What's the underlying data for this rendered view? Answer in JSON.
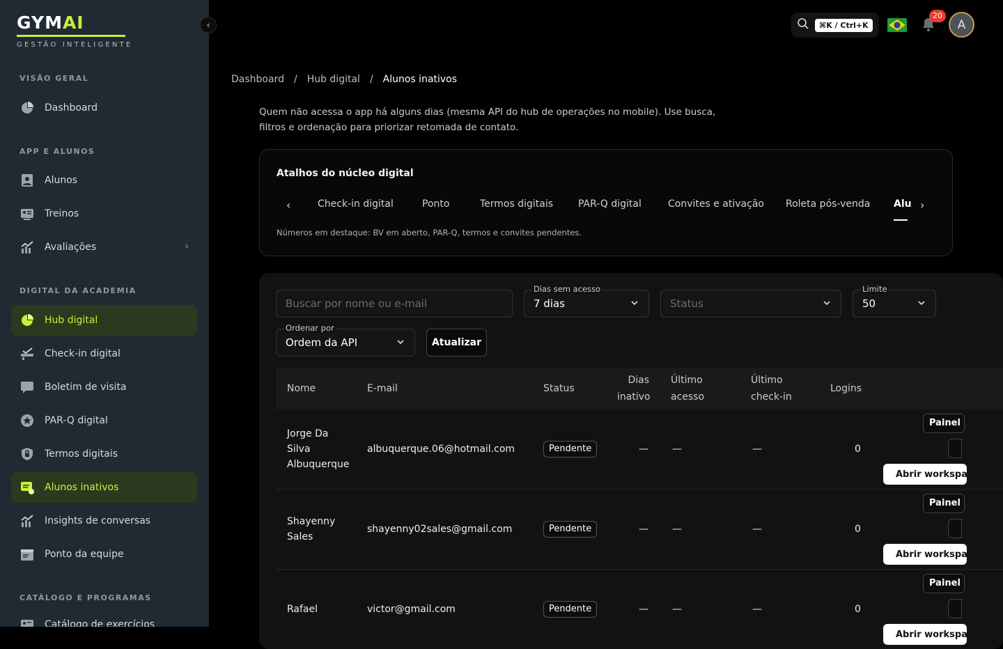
{
  "brand": {
    "logo_main": "GYM",
    "logo_accent": "AI",
    "tagline": "GESTÃO INTELIGENTE",
    "accent_color": "#c7ef3b"
  },
  "sidebar": {
    "sections": [
      {
        "label": "VISÃO GERAL"
      },
      {
        "label": "APP E ALUNOS"
      },
      {
        "label": "DIGITAL DA ACADEMIA"
      },
      {
        "label": "CATÁLOGO E PROGRAMAS"
      }
    ],
    "items": [
      {
        "label": "Dashboard",
        "icon": "pie-chart-icon"
      },
      {
        "label": "Alunos",
        "icon": "user-icon"
      },
      {
        "label": "Treinos",
        "icon": "id-card-icon"
      },
      {
        "label": "Avaliações",
        "icon": "chart-up-icon"
      },
      {
        "label": "Hub digital",
        "icon": "pie-chart-icon",
        "active": true
      },
      {
        "label": "Check-in digital",
        "icon": "checkin-icon"
      },
      {
        "label": "Boletim de visita",
        "icon": "chat-icon"
      },
      {
        "label": "PAR-Q digital",
        "icon": "star-badge-icon"
      },
      {
        "label": "Termos digitais",
        "icon": "lock-shield-icon"
      },
      {
        "label": "Alunos inativos",
        "icon": "message-alert-icon",
        "active": true
      },
      {
        "label": "Insights de conversas",
        "icon": "chart-up-icon"
      },
      {
        "label": "Ponto da equipe",
        "icon": "calendar-icon"
      },
      {
        "label": "Catálogo de exercícios",
        "icon": "id-card-icon"
      }
    ]
  },
  "topbar": {
    "shortcut": "⌘K / Ctrl+K",
    "notifications": "20",
    "avatar_initial": "A"
  },
  "breadcrumb": [
    "Dashboard",
    "/",
    "Hub digital",
    "/",
    "Alunos inativos"
  ],
  "description": "Quem não acessa o app há alguns dias (mesma API do hub de operações no mobile). Use busca, filtros e ordenação para priorizar retomada de contato.",
  "shortcuts_card": {
    "title": "Atalhos do núcleo digital",
    "tabs": [
      "Check-in digital",
      "Ponto",
      "Termos digitais",
      "PAR-Q digital",
      "Convites e ativação",
      "Roleta pós-venda",
      "Alu"
    ],
    "active_tab": "Alu",
    "note": "Números em destaque: BV em aberto, PAR-Q, termos e convites pendentes."
  },
  "filters": {
    "search_placeholder": "Buscar por nome ou e-mail",
    "days_label": "Dias sem acesso",
    "days_value": "7 dias",
    "status_placeholder": "Status",
    "limit_label": "Limite",
    "limit_value": "50",
    "order_label": "Ordenar por",
    "order_value": "Ordem da API",
    "refresh_label": "Atualizar"
  },
  "table": {
    "headers": {
      "name": "Nome",
      "email": "E-mail",
      "status": "Status",
      "days_inactive_1": "Dias",
      "days_inactive_2": "inativo",
      "last_access_1": "Último",
      "last_access_2": "acesso",
      "last_checkin_1": "Último",
      "last_checkin_2": "check-in",
      "logins": "Logins"
    },
    "actions": {
      "painel": "Painel",
      "abrir": "Abrir workspace"
    },
    "rows": [
      {
        "name_lines": [
          "Jorge Da",
          "Silva",
          "Albuquerque"
        ],
        "email": "albuquerque.06@hotmail.com",
        "status": "Pendente",
        "days": "—",
        "last_access": "—",
        "last_checkin": "—",
        "logins": "0"
      },
      {
        "name_lines": [
          "Shayenny",
          "Sales"
        ],
        "email": "shayenny02sales@gmail.com",
        "status": "Pendente",
        "days": "—",
        "last_access": "—",
        "last_checkin": "—",
        "logins": "0"
      },
      {
        "name_lines": [
          "Rafael"
        ],
        "email": "victor@gmail.com",
        "status": "Pendente",
        "days": "—",
        "last_access": "—",
        "last_checkin": "—",
        "logins": "0"
      }
    ]
  }
}
